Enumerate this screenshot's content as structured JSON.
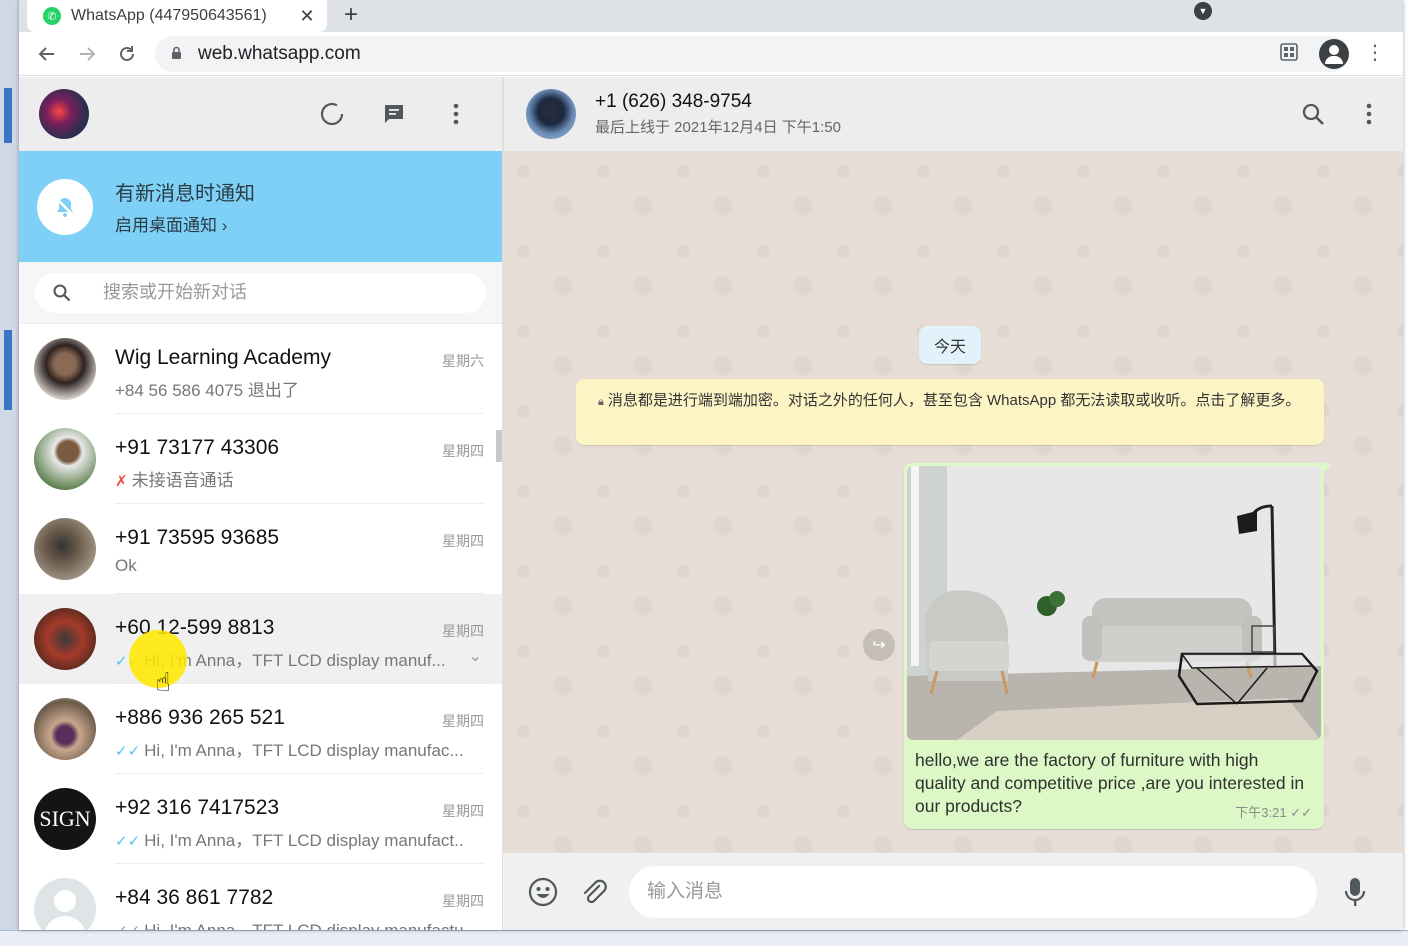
{
  "browser": {
    "tab_title": "WhatsApp  (447950643561)",
    "tab_close": "✕",
    "new_tab": "+",
    "url": "web.whatsapp.com"
  },
  "icons": {
    "back": "arrow-left-icon",
    "forward": "arrow-right-icon",
    "reload": "reload-icon",
    "lock": "lock-icon",
    "star": "star-icon"
  },
  "notification": {
    "title": "有新消息时通知",
    "subtitle": "启用桌面通知 ›"
  },
  "search": {
    "placeholder": "搜索或开始新对话"
  },
  "chats": [
    {
      "name": "Wig Learning Academy",
      "time": "星期六",
      "preview": "+84 56 586 4075 退出了",
      "avatar": "#4a3a38"
    },
    {
      "name": "+91 73177 43306",
      "time": "星期四",
      "preview": "未接语音通话",
      "avatar": "#7b6e55"
    },
    {
      "name": "+91 73595 93685",
      "time": "星期四",
      "preview": "Ok",
      "avatar": "#5d5446"
    },
    {
      "name": "+60 12-599 8813",
      "time": "星期四",
      "preview": "Hi, I'm Anna，TFT LCD display manuf...",
      "avatar": "#7a3b2c"
    },
    {
      "name": "+886 936 265 521",
      "time": "星期四",
      "preview": "Hi, I'm Anna，TFT LCD display manufac...",
      "avatar": "#8d7a6c"
    },
    {
      "name": "+92 316 7417523",
      "time": "星期四",
      "preview": "Hi, I'm Anna，TFT LCD display manufact...",
      "avatar": "#151515"
    },
    {
      "name": "+84 36 861 7782",
      "time": "星期四",
      "preview": "Hi, I'm Anna，TFT LCD display manufactu...",
      "avatar": "#cfd4d8"
    }
  ],
  "conversation": {
    "peer_name": "+1 (626) 348-9754",
    "peer_status": "最后上线于 2021年12月4日 下午1:50",
    "date_chip": "今天",
    "e2e_notice": "消息都是进行端到端加密。对话之外的任何人，甚至包含 WhatsApp 都无法读取或收听。点击了解更多。",
    "message": {
      "text": "hello,we are the factory of furniture with high quality and competitive price ,are you interested in our products?",
      "time": "下午3:21",
      "ticks": "✓✓"
    },
    "composer_placeholder": "输入消息"
  }
}
